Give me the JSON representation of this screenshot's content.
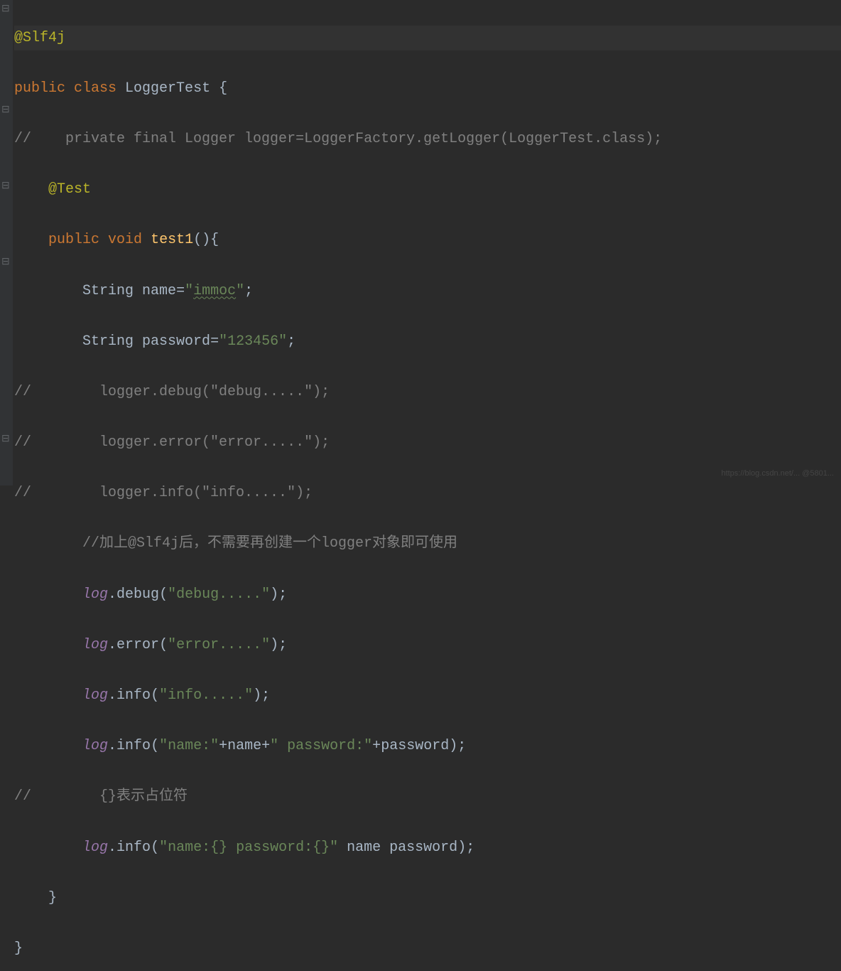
{
  "gutter": {
    "marks": [
      {
        "row": 0,
        "glyph": "⊟"
      },
      {
        "row": 4,
        "glyph": "⊟"
      },
      {
        "row": 7,
        "glyph": "⊟"
      },
      {
        "row": 10,
        "glyph": "⊟"
      },
      {
        "row": 17,
        "glyph": "⊟"
      }
    ]
  },
  "code": {
    "annotation": "@Slf4j",
    "class_decl": {
      "modifiers": "public class",
      "name": "LoggerTest",
      "brace": " {"
    },
    "commented_logger_decl": "//    private final Logger logger=LoggerFactory.getLogger(LoggerTest.class);",
    "test_annotation": "@Test",
    "method_decl": {
      "modifiers": "public void",
      "name": "test1",
      "params": "()",
      "brace": "{"
    },
    "var_name_decl": {
      "type": "String",
      "name": "name",
      "assign": "=",
      "open_quote": "\"",
      "value": "immoc",
      "close_quote": "\"",
      "semi": ";"
    },
    "var_password_decl": {
      "type": "String",
      "name": "password",
      "assign": "=",
      "value": "\"123456\"",
      "semi": ";"
    },
    "commented_logger_debug": "//        logger.debug(\"debug.....\");",
    "commented_logger_error": "//        logger.error(\"error.....\");",
    "commented_logger_info": "//        logger.info(\"info.....\");",
    "comment_slf4j_cn": "//加上@Slf4j后，不需要再创建一个logger对象即可使用",
    "log_debug": {
      "obj": "log",
      "dot": ".",
      "method": "debug",
      "open": "(",
      "arg": "\"debug.....\"",
      "close": ")",
      "semi": ";"
    },
    "log_error": {
      "obj": "log",
      "dot": ".",
      "method": "error",
      "open": "(",
      "arg": "\"error.....\"",
      "close": ")",
      "semi": ";"
    },
    "log_info1": {
      "obj": "log",
      "dot": ".",
      "method": "info",
      "open": "(",
      "arg": "\"info.....\"",
      "close": ")",
      "semi": ";"
    },
    "log_info_concat": {
      "obj": "log",
      "dot": ".",
      "method": "info",
      "open": "(",
      "part1": "\"name:\"",
      "plus1": "+",
      "var1": "name",
      "plus2": "+",
      "part2": "\" password:\"",
      "plus3": "+",
      "var2": "password",
      "close": ")",
      "semi": ";"
    },
    "comment_placeholder": "//        {}表示占位符",
    "log_info_fmt": {
      "obj": "log",
      "dot": ".",
      "method": "info",
      "open": "(",
      "fmt": "\"name:{} password:{}\"",
      "sp1": " ",
      "var1": "name",
      "sp2": " ",
      "var2": "password",
      "close": ")",
      "semi": ";"
    },
    "close_method": "}",
    "close_class": "}"
  },
  "indents": {
    "none": "",
    "one": "    ",
    "two": "        "
  },
  "watermark": "https://blog.csdn.net/... @5801..."
}
